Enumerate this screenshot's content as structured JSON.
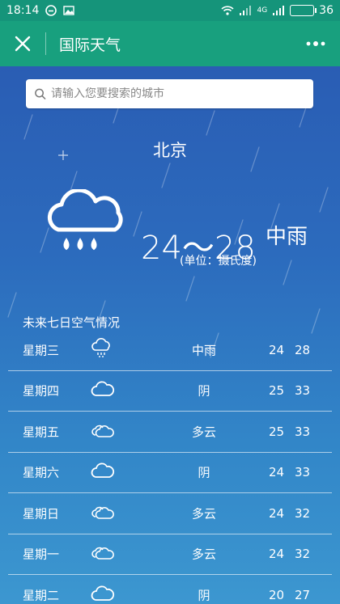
{
  "status_bar": {
    "time": "18:14",
    "network": "4G",
    "battery": "36"
  },
  "title_bar": {
    "title": "国际天气"
  },
  "search": {
    "placeholder": "请输入您要搜索的城市"
  },
  "current": {
    "city": "北京",
    "temperature_range": "24～28",
    "condition": "中雨",
    "unit_note": "(单位：摄氏度)"
  },
  "forecast": {
    "title": "未来七日空气情况",
    "days": [
      {
        "day": "星期三",
        "icon": "rain-cloud-icon",
        "condition": "中雨",
        "low": "24",
        "high": "28"
      },
      {
        "day": "星期四",
        "icon": "cloud-icon",
        "condition": "阴",
        "low": "25",
        "high": "33"
      },
      {
        "day": "星期五",
        "icon": "partly-cloudy-icon",
        "condition": "多云",
        "low": "25",
        "high": "33"
      },
      {
        "day": "星期六",
        "icon": "cloud-icon",
        "condition": "阴",
        "low": "24",
        "high": "33"
      },
      {
        "day": "星期日",
        "icon": "partly-cloudy-icon",
        "condition": "多云",
        "low": "24",
        "high": "32"
      },
      {
        "day": "星期一",
        "icon": "partly-cloudy-icon",
        "condition": "多云",
        "low": "24",
        "high": "32"
      },
      {
        "day": "星期二",
        "icon": "cloud-icon",
        "condition": "阴",
        "low": "20",
        "high": "27"
      }
    ]
  },
  "colors": {
    "title_bar": "#18a07e",
    "status_bar": "#15947a",
    "sky_top": "#2a5db4",
    "sky_bottom": "#3c97d0"
  }
}
